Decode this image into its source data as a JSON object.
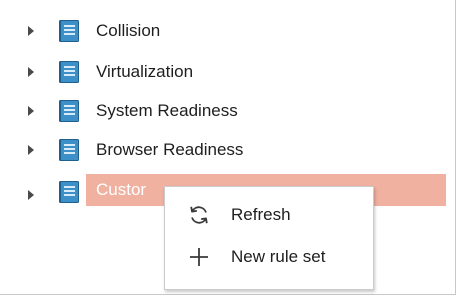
{
  "colors": {
    "book_fill": "#3d8fc8",
    "book_dark": "#1f5f8e",
    "selection": "#f0b1a0"
  },
  "tree": {
    "items": [
      {
        "label": "Collision",
        "icon": "book-icon"
      },
      {
        "label": "Virtualization",
        "icon": "book-icon"
      },
      {
        "label": "System Readiness",
        "icon": "book-icon"
      },
      {
        "label": "Browser Readiness",
        "icon": "book-icon"
      },
      {
        "label": "Custor",
        "icon": "book-icon",
        "selected": true
      }
    ]
  },
  "context_menu": {
    "items": [
      {
        "label": "Refresh",
        "icon": "refresh-icon"
      },
      {
        "label": "New rule set",
        "icon": "plus-icon"
      }
    ]
  }
}
